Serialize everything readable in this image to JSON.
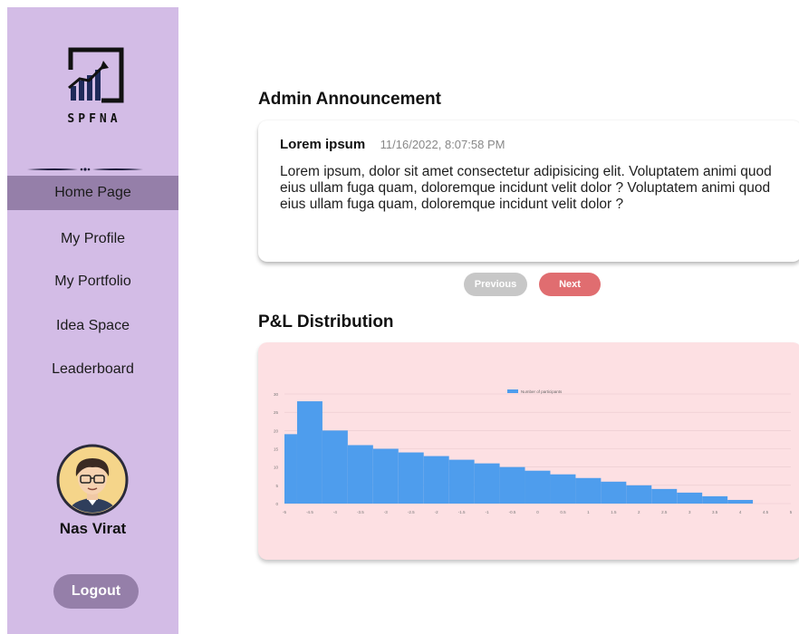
{
  "sidebar": {
    "logo_text": "SPFNA",
    "nav": [
      {
        "label": "Home Page",
        "active": true
      },
      {
        "label": "My Profile",
        "active": false
      },
      {
        "label": "My Portfolio",
        "active": false
      },
      {
        "label": "Idea Space",
        "active": false
      },
      {
        "label": "Leaderboard",
        "active": false
      }
    ],
    "user_name": "Nas Virat",
    "logout_label": "Logout"
  },
  "announcement": {
    "section_title": "Admin Announcement",
    "title": "Lorem ipsum",
    "timestamp": "11/16/2022, 8:07:58 PM",
    "body": "Lorem ipsum, dolor sit amet consectetur adipisicing elit. Voluptatem animi quod eius ullam fuga quam, doloremque incidunt velit dolor ? Voluptatem animi quod eius ullam fuga quam, doloremque incidunt velit dolor ?",
    "prev_label": "Previous",
    "next_label": "Next"
  },
  "distribution": {
    "section_title": "P&L Distribution"
  },
  "colors": {
    "sidebar_bg": "#d3bce6",
    "nav_active": "#957fa9",
    "next_button": "#e06d70",
    "prev_button": "#c7c7c7",
    "chart_bg": "#fde0e3",
    "bar_color": "#4e9ded"
  },
  "chart_data": {
    "type": "bar",
    "legend": [
      "Number of participants"
    ],
    "legend_position": "top",
    "grid": true,
    "x_ticks": [
      "-5",
      "-4.5",
      "-4",
      "-3.5",
      "-3",
      "-2.5",
      "-2",
      "-1.5",
      "-1",
      "-0.5",
      "0",
      "0.5",
      "1",
      "1.5",
      "2",
      "2.5",
      "3",
      "3.5",
      "4",
      "4.5",
      "5"
    ],
    "y_ticks": [
      "0",
      "5",
      "10",
      "15",
      "20",
      "25",
      "30"
    ],
    "ylim": [
      0,
      30
    ],
    "bin_starts": [
      -5,
      -4.75,
      -4.25,
      -3.75,
      -3.25,
      -2.75,
      -2.25,
      -1.75,
      -1.25,
      -0.75,
      -0.25,
      0.25,
      0.75,
      1.25,
      1.75,
      2.25,
      2.75,
      3.25,
      3.75,
      4.25
    ],
    "bin_ends": [
      -4.75,
      -4.25,
      -3.75,
      -3.25,
      -2.75,
      -2.25,
      -1.75,
      -1.25,
      -0.75,
      -0.25,
      0.25,
      0.75,
      1.25,
      1.75,
      2.25,
      2.75,
      3.25,
      3.75,
      4.25,
      4.25
    ],
    "series": [
      {
        "name": "Number of participants",
        "values": [
          19,
          28,
          20,
          16,
          15,
          14,
          13,
          12,
          11,
          10,
          9,
          8,
          7,
          6,
          5,
          4,
          3,
          2,
          1,
          0
        ]
      }
    ]
  }
}
